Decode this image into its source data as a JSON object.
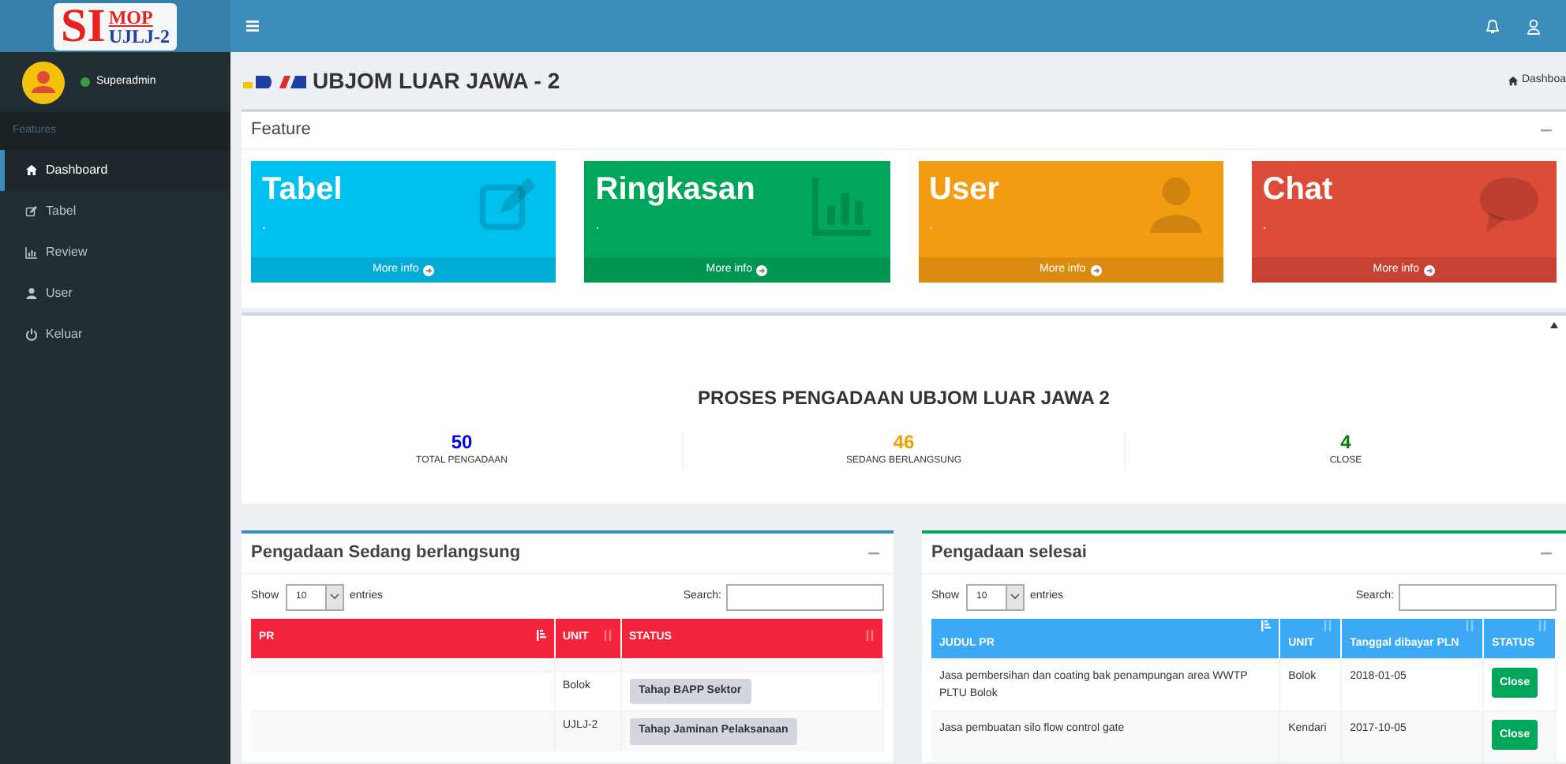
{
  "logo": {
    "main": "SI",
    "top": "MOP",
    "bottom": "UJLJ-2"
  },
  "user": {
    "name": "Superadmin"
  },
  "sidebar": {
    "header": "Features",
    "items": [
      {
        "label": "Dashboard",
        "kind": "home",
        "selected": true
      },
      {
        "label": "Tabel",
        "kind": "edit",
        "selected": false
      },
      {
        "label": "Review",
        "kind": "chart",
        "selected": false
      },
      {
        "label": "User",
        "kind": "user",
        "selected": false
      },
      {
        "label": "Keluar",
        "kind": "power",
        "selected": false
      }
    ]
  },
  "page_title": "UBJOM LUAR JAWA - 2",
  "breadcrumb": "Dashboa",
  "feature_box": {
    "title": "Feature",
    "cards": [
      {
        "title": "Tabel",
        "value": ".",
        "link": "More info",
        "kind": "edit",
        "color": "#00c0ef"
      },
      {
        "title": "Ringkasan",
        "value": ".",
        "link": "More info",
        "kind": "chart",
        "color": "#00a65a"
      },
      {
        "title": "User",
        "value": ".",
        "link": "More info",
        "kind": "user",
        "color": "#f39c12"
      },
      {
        "title": "Chat",
        "value": ".",
        "link": "More info",
        "kind": "chat",
        "color": "#dd4b39"
      }
    ]
  },
  "summary": {
    "title": "PROSES PENGADAAN UBJOM LUAR JAWA 2",
    "stats": [
      {
        "value": "50",
        "label": "TOTAL PENGADAAN",
        "color": "#0000ee"
      },
      {
        "value": "46",
        "label": "SEDANG BERLANGSUNG",
        "color": "#f5a000"
      },
      {
        "value": "4",
        "label": "CLOSE",
        "color": "#008000"
      }
    ]
  },
  "tables": [
    {
      "title": "Pengadaan Sedang berlangsung",
      "show": "Show",
      "length": "10",
      "entries": "entries",
      "search": "Search:",
      "columns": [
        {
          "label": "PR",
          "sorted": true
        },
        {
          "label": "UNIT",
          "sorted": false
        },
        {
          "label": "STATUS",
          "sorted": false
        }
      ],
      "rows": [
        {
          "cells": [
            "",
            "Bolok",
            "Tahap BAPP Sektor"
          ]
        },
        {
          "cells": [
            "",
            "UJLJ-2",
            "Tahap Jaminan Pelaksanaan"
          ]
        }
      ]
    },
    {
      "title": "Pengadaan selesai",
      "show": "Show",
      "length": "10",
      "entries": "entries",
      "search": "Search:",
      "columns": [
        {
          "label": "JUDUL PR",
          "sorted": true
        },
        {
          "label": "UNIT",
          "sorted": false
        },
        {
          "label": "Tanggal dibayar PLN",
          "sorted": false
        },
        {
          "label": "STATUS",
          "sorted": false
        }
      ],
      "rows": [
        {
          "cells": [
            "Jasa pembersihan dan coating bak penampungan area WWTP PLTU Bolok",
            "Bolok",
            "2018-01-05",
            "Close"
          ]
        },
        {
          "cells": [
            "Jasa pembuatan silo flow control gate",
            "Kendari",
            "2017-10-05",
            "Close"
          ]
        }
      ]
    }
  ]
}
